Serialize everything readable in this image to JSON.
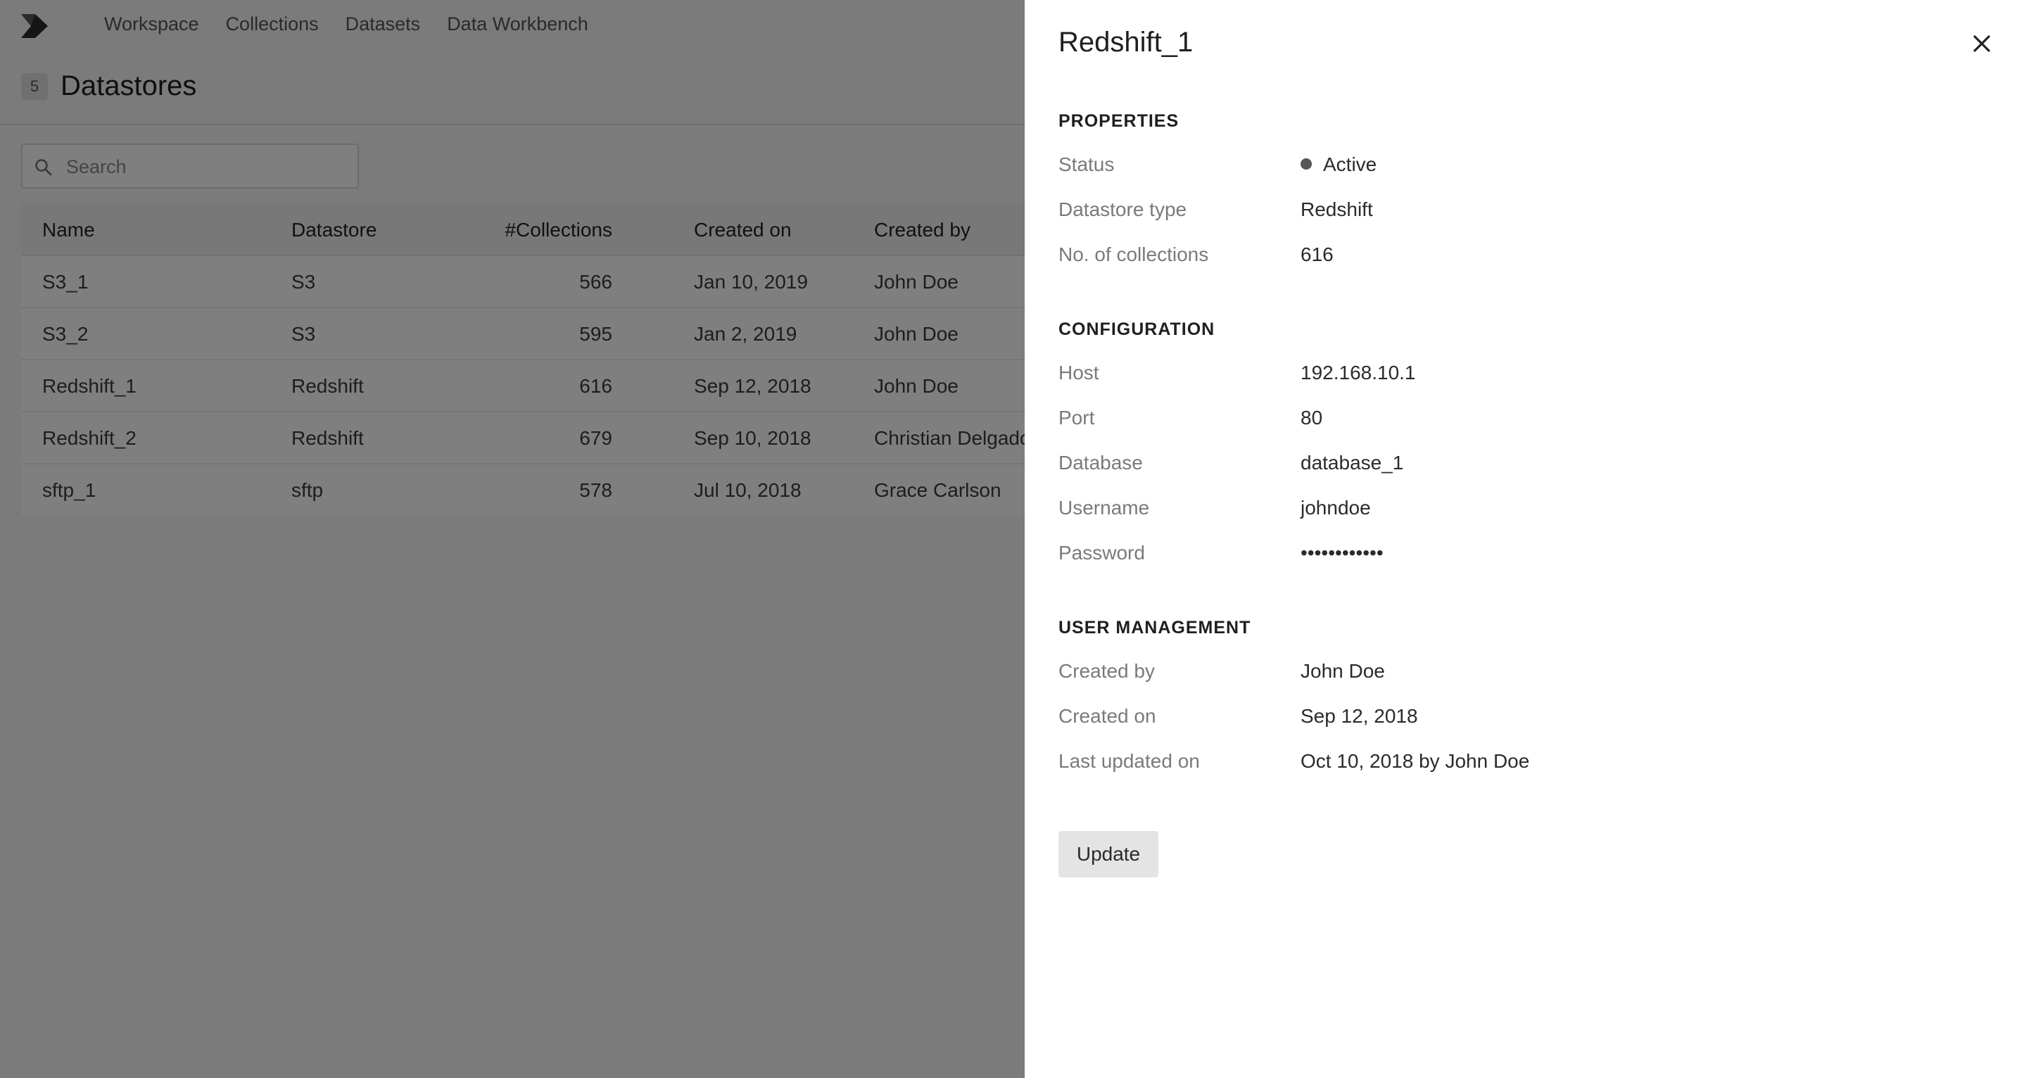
{
  "nav": {
    "items": [
      "Workspace",
      "Collections",
      "Datasets",
      "Data Workbench"
    ]
  },
  "page": {
    "count": "5",
    "title": "Datastores"
  },
  "search": {
    "placeholder": "Search",
    "value": ""
  },
  "table": {
    "columns": [
      "Name",
      "Datastore",
      "#Collections",
      "Created on",
      "Created by"
    ],
    "rows": [
      {
        "name": "S3_1",
        "datastore": "S3",
        "collections": "566",
        "created_on": "Jan 10, 2019",
        "created_by": "John Doe"
      },
      {
        "name": "S3_2",
        "datastore": "S3",
        "collections": "595",
        "created_on": "Jan 2, 2019",
        "created_by": "John Doe"
      },
      {
        "name": "Redshift_1",
        "datastore": "Redshift",
        "collections": "616",
        "created_on": "Sep 12, 2018",
        "created_by": "John Doe"
      },
      {
        "name": "Redshift_2",
        "datastore": "Redshift",
        "collections": "679",
        "created_on": "Sep 10, 2018",
        "created_by": "Christian Delgado"
      },
      {
        "name": "sftp_1",
        "datastore": "sftp",
        "collections": "578",
        "created_on": "Jul 10, 2018",
        "created_by": "Grace Carlson"
      }
    ]
  },
  "drawer": {
    "title": "Redshift_1",
    "close_icon": "close-icon",
    "properties": {
      "heading": "PROPERTIES",
      "status_label": "Status",
      "status_value": "Active",
      "type_label": "Datastore type",
      "type_value": "Redshift",
      "collections_label": "No. of collections",
      "collections_value": "616"
    },
    "configuration": {
      "heading": "CONFIGURATION",
      "host_label": "Host",
      "host_value": "192.168.10.1",
      "port_label": "Port",
      "port_value": "80",
      "database_label": "Database",
      "database_value": "database_1",
      "username_label": "Username",
      "username_value": "johndoe",
      "password_label": "Password",
      "password_value": "••••••••••••"
    },
    "user_management": {
      "heading": "USER MANAGEMENT",
      "created_by_label": "Created by",
      "created_by_value": "John Doe",
      "created_on_label": "Created on",
      "created_on_value": "Sep 12, 2018",
      "updated_label": "Last updated on",
      "updated_value": "Oct 10, 2018 by John Doe"
    },
    "update_label": "Update"
  },
  "colors": {
    "overlay": "#000000",
    "status_dot": "#555555",
    "button_bg": "#e4e4e4"
  }
}
